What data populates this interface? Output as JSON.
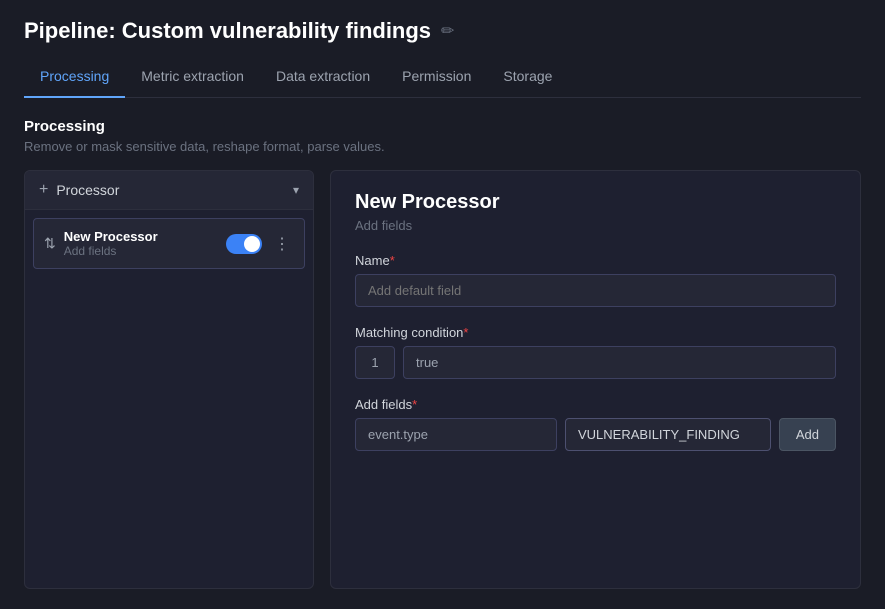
{
  "header": {
    "title": "Pipeline: Custom vulnerability findings",
    "edit_icon": "✏"
  },
  "tabs": [
    {
      "id": "processing",
      "label": "Processing",
      "active": true
    },
    {
      "id": "metric-extraction",
      "label": "Metric extraction",
      "active": false
    },
    {
      "id": "data-extraction",
      "label": "Data extraction",
      "active": false
    },
    {
      "id": "permission",
      "label": "Permission",
      "active": false
    },
    {
      "id": "storage",
      "label": "Storage",
      "active": false
    }
  ],
  "section": {
    "title": "Processing",
    "description": "Remove or mask sensitive data, reshape format, parse values."
  },
  "left_panel": {
    "add_processor_label": "Processor",
    "processor_item": {
      "name": "New Processor",
      "sub": "Add fields",
      "toggle_on": true
    }
  },
  "right_panel": {
    "title": "New Processor",
    "subtitle": "Add fields",
    "name_label": "Name",
    "name_placeholder": "Add default field",
    "matching_label": "Matching condition",
    "matching_number": "1",
    "matching_value": "true",
    "add_fields_label": "Add fields",
    "field_key_value": "event.type",
    "field_value_value": "VULNERABILITY_FINDING",
    "add_button_label": "Add"
  }
}
